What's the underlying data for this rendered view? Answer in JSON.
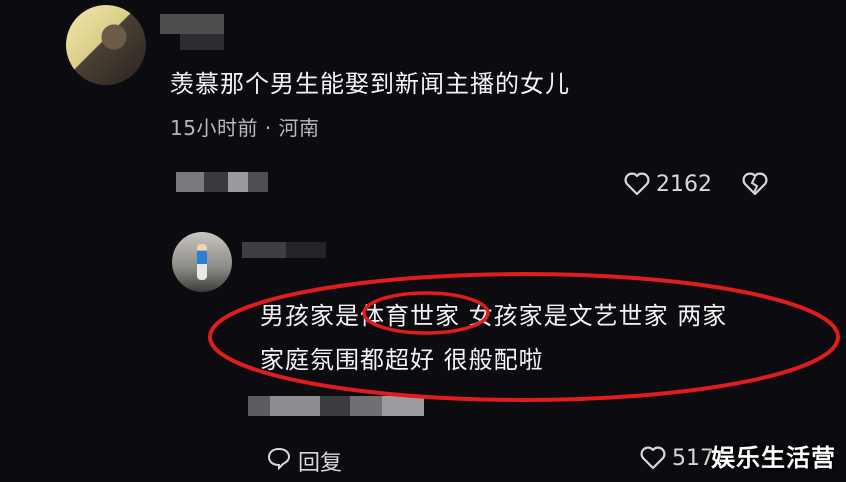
{
  "comment": {
    "text": "羡慕那个男生能娶到新闻主播的女儿",
    "meta": "15小时前 · 河南",
    "likes": "2162"
  },
  "reply": {
    "line1": "男孩家是体育世家 女孩家是文艺世家 两家",
    "line2": "家庭氛围都超好 很般配啦",
    "reply_label": "回复",
    "likes": "517"
  },
  "watermark": "娱乐生活营",
  "colors": {
    "background": "#0b0b10",
    "annotation_red": "#e01c1c",
    "text": "#f4f4f4",
    "meta": "#b7b7bd"
  },
  "icons": {
    "like": "heart-outline-icon",
    "dislike": "broken-heart-icon",
    "reply": "speech-bubble-icon"
  }
}
